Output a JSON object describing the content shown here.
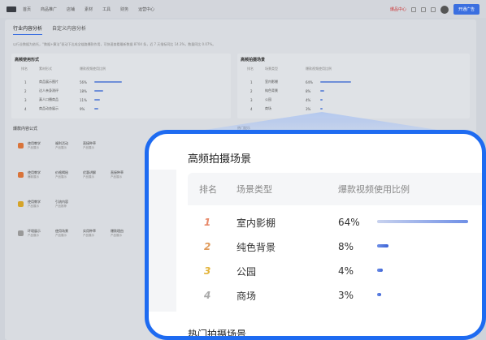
{
  "nav": {
    "items": [
      "首页",
      "商品推广",
      "店铺",
      "素材",
      "工具",
      "财务",
      "运营中心"
    ],
    "right_tag": "爆品中心",
    "cta": "开通广告"
  },
  "tabs": [
    "行业内容分析",
    "自定义内容分析"
  ],
  "description": "以行业数据为依托，“数据+算法”驱动下达成全链路爆款作用，可快速查看最新数据 8704 条，近 7 天指标同比 14.3%，数量同比 0.07%。",
  "left_panel": {
    "title": "高频使用形式",
    "headers": [
      "排名",
      "素材形式",
      "爆款视频使用比例"
    ],
    "rows": [
      {
        "rank": "1",
        "name": "商品展示图片",
        "pct": "56%",
        "fraction": 0.56
      },
      {
        "rank": "2",
        "name": "达人亲身测评",
        "pct": "18%",
        "fraction": 0.18
      },
      {
        "rank": "3",
        "name": "真人口播商品",
        "pct": "11%",
        "fraction": 0.11
      },
      {
        "rank": "4",
        "name": "商品动态展示",
        "pct": "9%",
        "fraction": 0.09
      }
    ]
  },
  "right_panel": {
    "title": "高频拍摄场景",
    "headers": [
      "排名",
      "场景类型",
      "爆款视频使用比例"
    ],
    "rows": [
      {
        "rank": "1",
        "name": "室内影棚",
        "pct": "64%",
        "fraction": 0.64
      },
      {
        "rank": "2",
        "name": "纯色背景",
        "pct": "8%",
        "fraction": 0.08
      },
      {
        "rank": "3",
        "name": "公园",
        "pct": "4%",
        "fraction": 0.04
      },
      {
        "rank": "4",
        "name": "商场",
        "pct": "3%",
        "fraction": 0.03
      }
    ]
  },
  "formula": {
    "title": "爆款内容公式",
    "cards": [
      {
        "tags": [
          [
            "使用教学",
            "产品展示"
          ],
          [
            "福利活动",
            "产品展示"
          ],
          [
            "直接种草",
            "产品展示"
          ]
        ],
        "color": "orange"
      },
      {
        "tags": [
          [
            "使用教学",
            "爆款展示"
          ],
          [
            "价格揭秘",
            "产品展示"
          ],
          [
            "优惠讲解",
            "产品展示"
          ],
          [
            "直接种草",
            "产品展示"
          ]
        ],
        "color": "orange"
      },
      {
        "tags": [
          [
            "使用教学",
            "产品展示"
          ],
          [
            "引流内容",
            "产品推荐"
          ]
        ],
        "color": "yellow"
      },
      {
        "tags": [
          [
            "环境展示",
            "产品展示"
          ],
          [
            "使用场景",
            "产品展示"
          ],
          [
            "实用种草",
            "产品展示"
          ],
          [
            "爆款理由",
            "产品展示"
          ]
        ],
        "color": "gray"
      }
    ]
  },
  "side_hint": "热门配乐",
  "zoom": {
    "title": "高频拍摄场景",
    "headers": {
      "rank": "排名",
      "scene": "场景类型",
      "ratio": "爆款视频使用比例"
    },
    "rows": [
      {
        "rank": "1",
        "scene": "室内影棚",
        "pct": "64%",
        "fraction": 0.64,
        "rank_color": "#e8896a"
      },
      {
        "rank": "2",
        "scene": "纯色背景",
        "pct": "8%",
        "fraction": 0.08,
        "rank_color": "#e09a5a"
      },
      {
        "rank": "3",
        "scene": "公园",
        "pct": "4%",
        "fraction": 0.04,
        "rank_color": "#e3b43b"
      },
      {
        "rank": "4",
        "scene": "商场",
        "pct": "3%",
        "fraction": 0.03,
        "rank_color": "#aaaaaa"
      }
    ],
    "bottom_label": "热门拍摄场景"
  },
  "colors": {
    "accent": "#1e6bf1",
    "bar": "#3b63d6"
  }
}
